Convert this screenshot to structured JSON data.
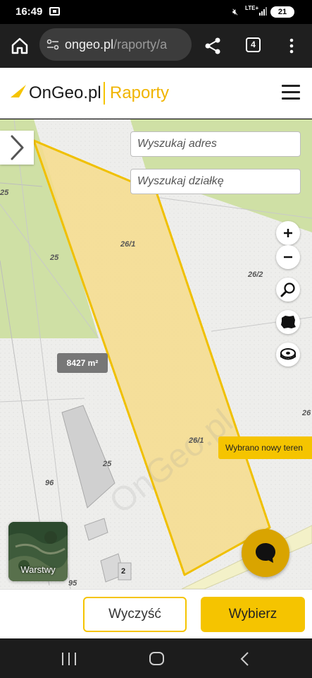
{
  "status_bar": {
    "time": "16:49",
    "network": "LTE+",
    "battery": "21",
    "icons": [
      "screen-record-icon",
      "mute-icon",
      "signal-icon",
      "battery-icon"
    ]
  },
  "browser": {
    "url_host": "ongeo.pl",
    "url_path": "/raporty/a",
    "tab_count": "4",
    "icons": [
      "home-icon",
      "site-settings-icon",
      "share-icon",
      "tabs-icon",
      "more-vert-icon"
    ]
  },
  "header": {
    "logo_text": "OnGeo.pl",
    "section": "Raporty",
    "icons": [
      "logo-icon",
      "hamburger-menu-icon"
    ]
  },
  "search": {
    "address_placeholder": "Wyszukaj adres",
    "parcel_placeholder": "Wyszukaj działkę"
  },
  "map": {
    "parcel_labels": [
      "26/1",
      "25",
      "25",
      "26/2",
      "26/1",
      "25",
      "96",
      "26",
      "2",
      "95"
    ],
    "selected_area": "8427 m²",
    "toast": "Wybrano nowy teren",
    "layers_label": "Warstwy",
    "watermark": "OnGeo.pl",
    "tools": [
      "zoom-in-icon",
      "zoom-out-icon",
      "magnifier-icon",
      "poland-map-icon",
      "tape-measure-icon"
    ],
    "colors": {
      "selected_fill": "#f6dc8c",
      "selected_outline": "#f0c000",
      "forest": "#cfe0a5"
    }
  },
  "actions": {
    "clear": "Wyczyść",
    "select": "Wybierz"
  },
  "colors": {
    "accent": "#f5c400"
  }
}
